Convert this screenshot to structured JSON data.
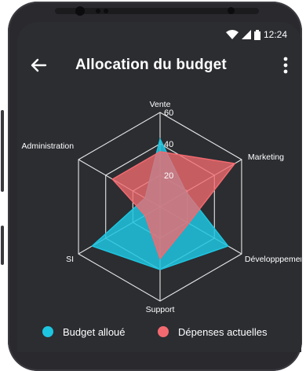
{
  "app": {
    "title": "Allocation du budget",
    "time": "12:24"
  },
  "icons": {
    "back": "arrow-left-icon",
    "menu": "more-vert-icon",
    "wifi": "wifi-icon",
    "signal": "signal-icon",
    "battery": "battery-icon"
  },
  "colors": {
    "budget": "#1ec5e0",
    "depenses": "#f26a70",
    "screen_bg": "#2b2d31"
  },
  "chart_data": {
    "type": "radar",
    "axes": [
      "Vente",
      "Marketing",
      "Développpement",
      "Support",
      "SI",
      "Administration"
    ],
    "range": [
      0,
      60
    ],
    "ticks": [
      20,
      40,
      60
    ],
    "tick_labels": [
      "20",
      "40",
      "60"
    ],
    "grid": true,
    "legend_position": "bottom",
    "series": [
      {
        "name": "Budget alloué",
        "values": [
          43,
          19,
          50,
          40,
          50,
          11
        ]
      },
      {
        "name": "Dépenses actuelles",
        "values": [
          35,
          55,
          21,
          33,
          11,
          35
        ]
      }
    ]
  }
}
